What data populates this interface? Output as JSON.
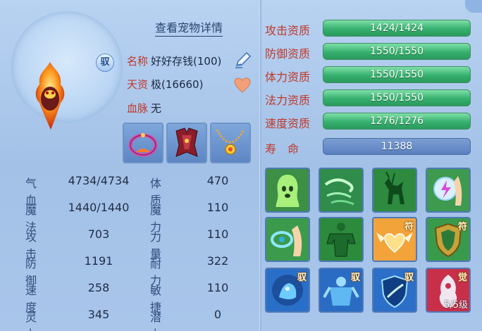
{
  "header": {
    "view_details": "查看宠物详情"
  },
  "pet": {
    "name_label": "名称",
    "name_value": "好好存钱(100)",
    "aptitude_label": "天资",
    "aptitude_value": "极(16660)",
    "bloodline_label": "血脉",
    "bloodline_value": "无",
    "tag": "驭"
  },
  "stats": {
    "hp_label": "气血",
    "hp_value": "4734/4734",
    "mp_label": "魔法",
    "mp_value": "1440/1440",
    "atk_label": "攻击",
    "atk_value": "703",
    "def_label": "防御",
    "def_value": "1191",
    "spd_label": "速度",
    "spd_value": "258",
    "spirit_label": "灵力",
    "spirit_value": "345",
    "con_label": "体质",
    "con_value": "470",
    "mag_label": "魔力",
    "mag_value": "110",
    "str_label": "力量",
    "str_value": "110",
    "end_label": "耐力",
    "end_value": "322",
    "agi_label": "敏捷",
    "agi_value": "110",
    "pot_label": "潜力",
    "pot_value": "0"
  },
  "qualities": {
    "atk_label": "攻击资质",
    "atk_value": "1424/1424",
    "atk_fill": 1.0,
    "def_label": "防御资质",
    "def_value": "1550/1550",
    "def_fill": 1.0,
    "hp_label": "体力资质",
    "hp_value": "1550/1550",
    "hp_fill": 1.0,
    "mag_label": "法力资质",
    "mag_value": "1550/1550",
    "mag_fill": 1.0,
    "spd_label": "速度资质",
    "spd_value": "1276/1276",
    "spd_fill": 1.0,
    "life_label": "寿　命",
    "life_value": "11388"
  },
  "skills": {
    "badge_fu": "符",
    "badge_yu": "驭",
    "badge_jue": "觉",
    "awaken_level": "5/5级"
  },
  "colors": {
    "quality_bar": "#36b06e",
    "label_red": "#c0392b",
    "panel": "#a9c6ea"
  }
}
